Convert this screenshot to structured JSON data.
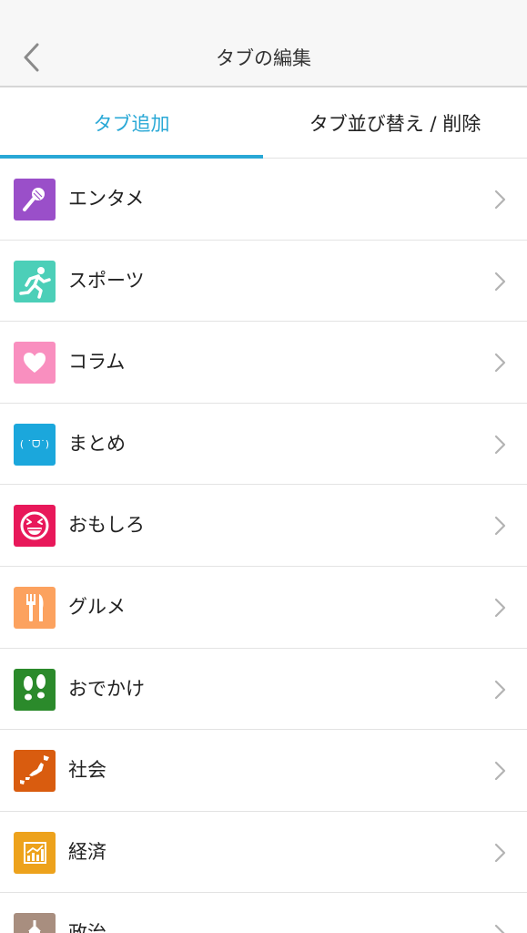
{
  "header": {
    "title": "タブの編集",
    "back_icon": "chevron-left-icon"
  },
  "tabs": [
    {
      "label": "タブ追加",
      "active": true
    },
    {
      "label": "タブ並び替え / 削除",
      "active": false
    }
  ],
  "colors": {
    "accent": "#29a8d6",
    "text": "#222222",
    "divider": "#e3e3e3",
    "chevron": "#b3b3b3"
  },
  "categories": [
    {
      "label": "エンタメ",
      "icon": "microphone-icon",
      "color": "#9a4fc9"
    },
    {
      "label": "スポーツ",
      "icon": "runner-icon",
      "color": "#4ccfb8"
    },
    {
      "label": "コラム",
      "icon": "heart-icon",
      "color": "#f98fbf"
    },
    {
      "label": "まとめ",
      "icon": "kaomoji-icon",
      "icon_text": "( ˙ᗜ˙)",
      "color": "#1ba7dc"
    },
    {
      "label": "おもしろ",
      "icon": "laughing-face-icon",
      "color": "#e8185a"
    },
    {
      "label": "グルメ",
      "icon": "fork-knife-icon",
      "color": "#fca25f"
    },
    {
      "label": "おでかけ",
      "icon": "footprints-icon",
      "color": "#2b8a2b"
    },
    {
      "label": "社会",
      "icon": "japan-map-icon",
      "color": "#d95c0f"
    },
    {
      "label": "経済",
      "icon": "bar-chart-icon",
      "color": "#eda21c"
    },
    {
      "label": "政治",
      "icon": "parliament-icon",
      "color": "#a88e7f"
    }
  ]
}
